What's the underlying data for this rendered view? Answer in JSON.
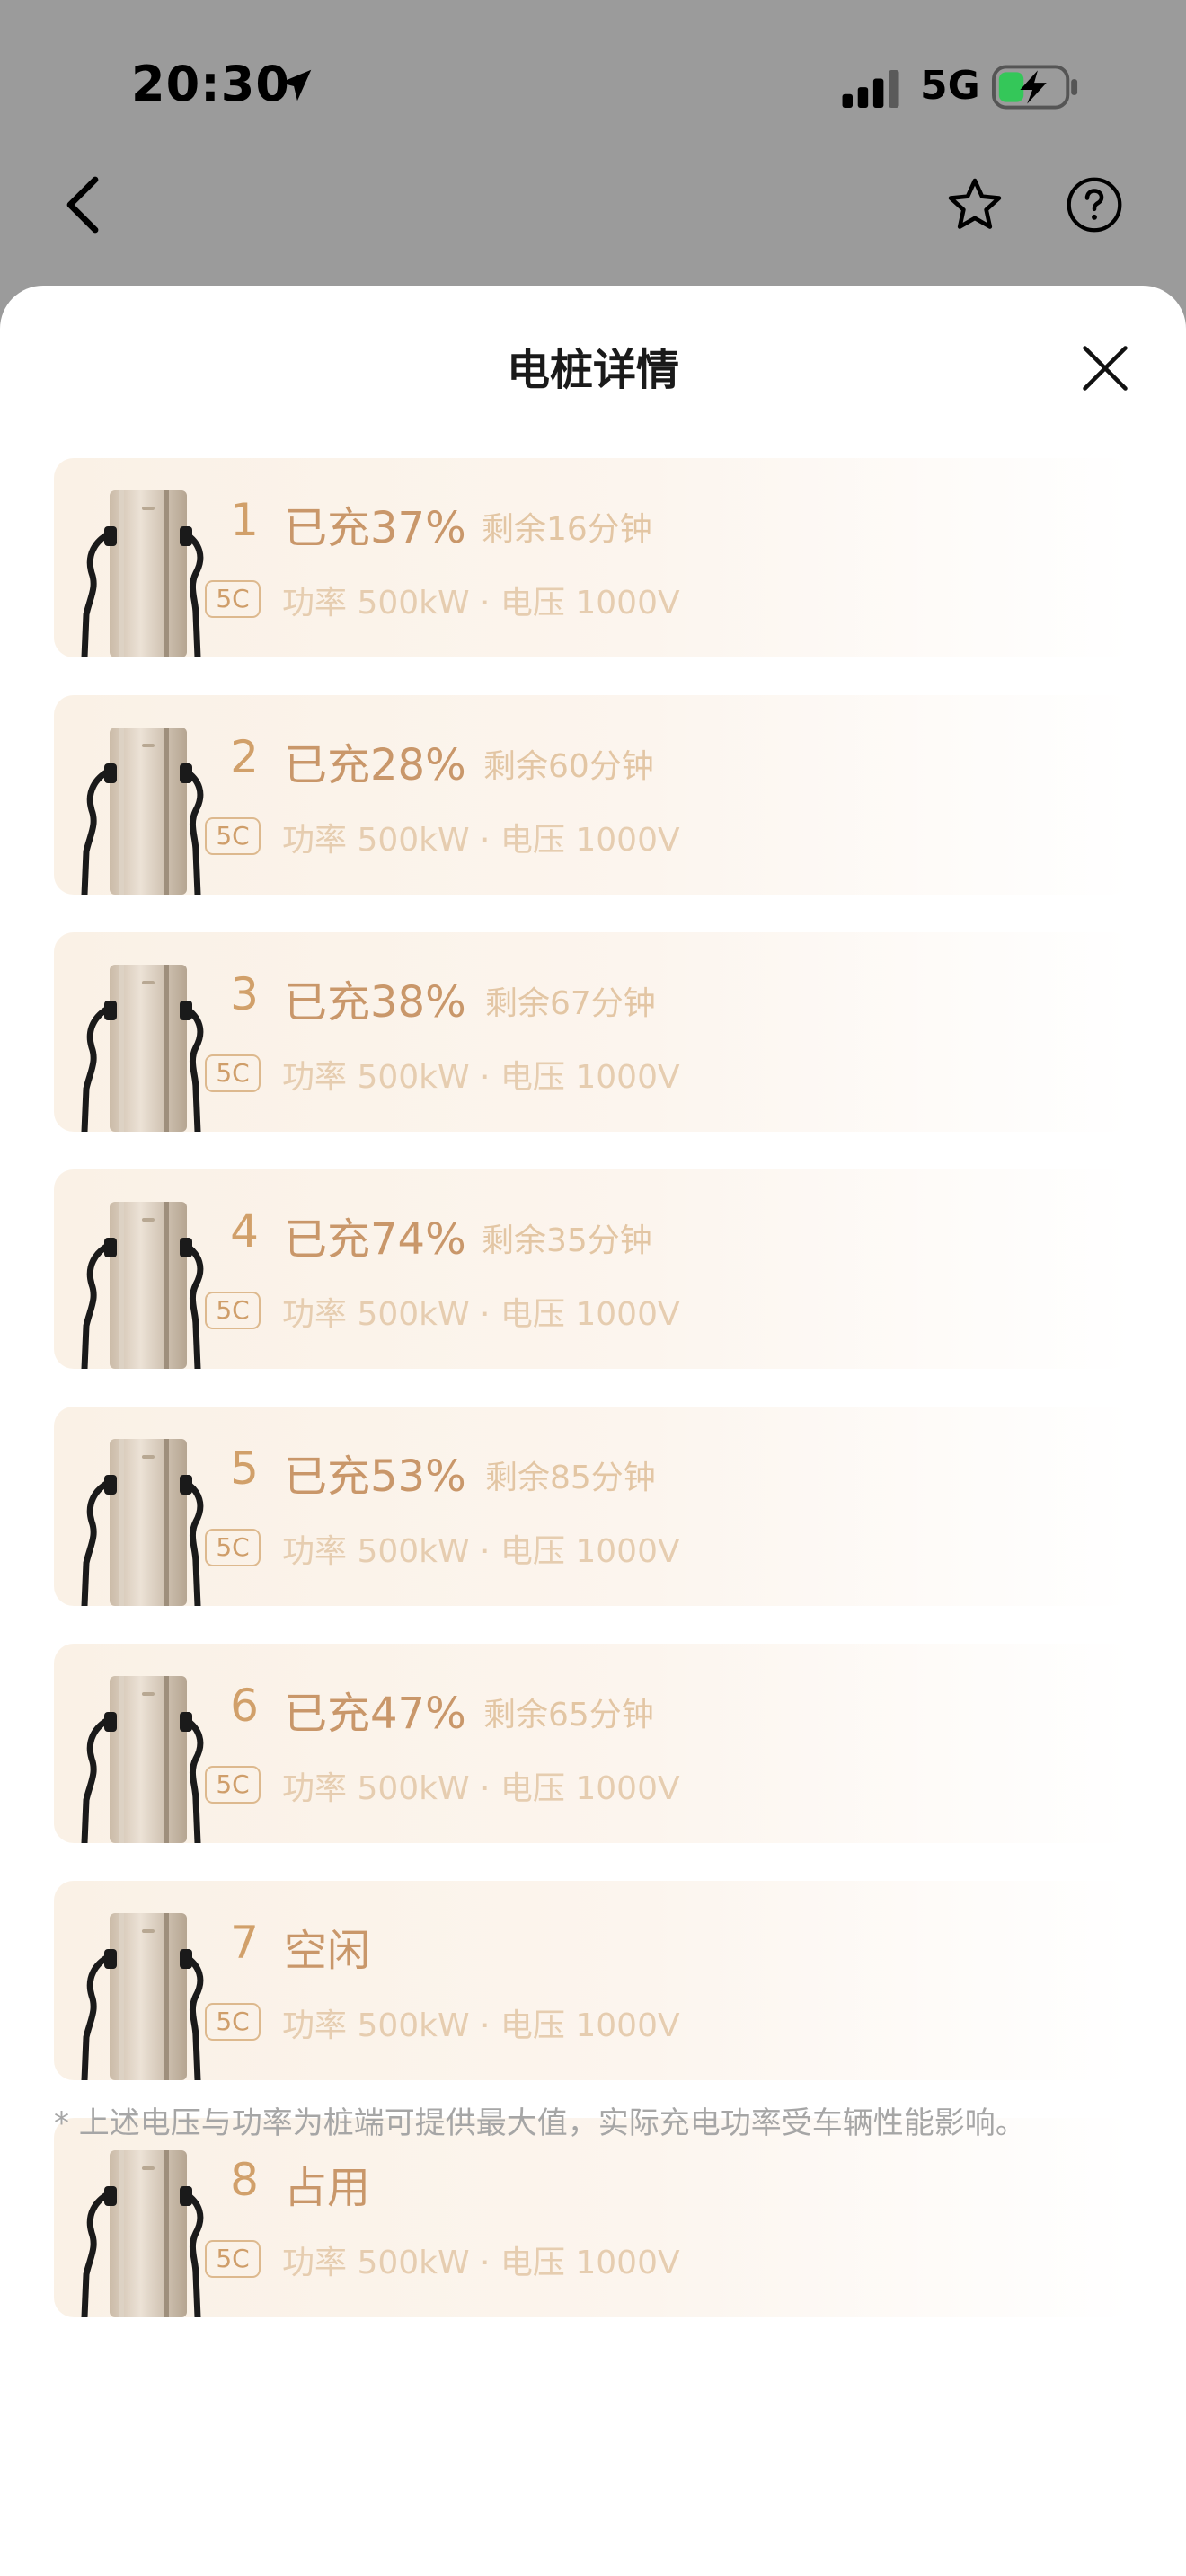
{
  "status_bar": {
    "time": "20:30",
    "network": "5G",
    "location_icon": "location-arrow-icon",
    "signal_icon": "cell-signal-icon",
    "battery_icon": "battery-charging-icon",
    "battery_color": "#34c759"
  },
  "nav": {
    "back_icon": "chevron-left-icon",
    "favorite_icon": "star-outline-icon",
    "help_icon": "question-circle-icon"
  },
  "sheet": {
    "title": "电桩详情",
    "close_icon": "close-x-icon"
  },
  "colors": {
    "accent": "#c9976a",
    "card_bg": "#faf1e6",
    "muted_text": "#e6cdb0",
    "overlay": "#9b9b9b"
  },
  "badge_label": "5C",
  "spec_text": "功率 500kW · 电压 1000V",
  "piles": [
    {
      "number": "1",
      "status": "已充37%",
      "remaining": "剩余16分钟"
    },
    {
      "number": "2",
      "status": "已充28%",
      "remaining": "剩余60分钟"
    },
    {
      "number": "3",
      "status": "已充38%",
      "remaining": "剩余67分钟"
    },
    {
      "number": "4",
      "status": "已充74%",
      "remaining": "剩余35分钟"
    },
    {
      "number": "5",
      "status": "已充53%",
      "remaining": "剩余85分钟"
    },
    {
      "number": "6",
      "status": "已充47%",
      "remaining": "剩余65分钟"
    },
    {
      "number": "7",
      "status": "空闲",
      "remaining": ""
    },
    {
      "number": "8",
      "status": "占用",
      "remaining": ""
    }
  ],
  "footnote": "* 上述电压与功率为桩端可提供最大值，实际充电功率受车辆性能影响。"
}
